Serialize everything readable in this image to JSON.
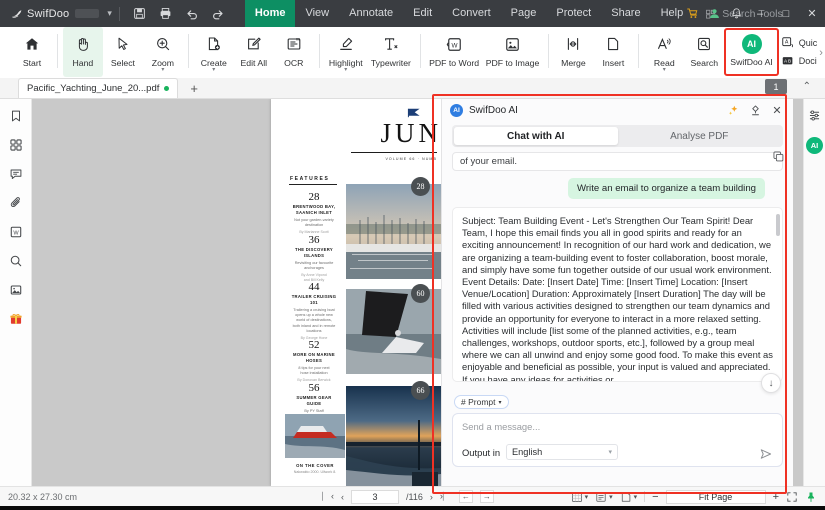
{
  "titlebar": {
    "brand": "SwifDoo",
    "logo_icon": "swifdoo-bird-logo",
    "dropdown_icon": "chevron-down-icon",
    "quick_icons": [
      "save-icon",
      "print-icon",
      "undo-icon",
      "redo-icon"
    ],
    "menus": [
      {
        "label": "Home",
        "active": true
      },
      {
        "label": "View",
        "active": false
      },
      {
        "label": "Annotate",
        "active": false
      },
      {
        "label": "Edit",
        "active": false
      },
      {
        "label": "Convert",
        "active": false
      },
      {
        "label": "Page",
        "active": false
      },
      {
        "label": "Protect",
        "active": false
      },
      {
        "label": "Share",
        "active": false
      },
      {
        "label": "Help",
        "active": false
      }
    ],
    "search_placeholder": "Search Tools",
    "search_icon": "search-tools-icon",
    "right_icons": [
      "cart-icon",
      "account-icon",
      "bell-icon"
    ],
    "window_buttons": {
      "minimize": "–",
      "maximize": "□",
      "close": "✕"
    },
    "accent_active": "#0d8f63",
    "bg": "#3a3d41"
  },
  "ribbon": {
    "groups": [
      {
        "items": [
          {
            "label": "Start",
            "icon": "home-icon",
            "selected": false,
            "caret": false
          }
        ]
      },
      {
        "items": [
          {
            "label": "Hand",
            "icon": "hand-icon",
            "selected": true,
            "caret": false
          },
          {
            "label": "Select",
            "icon": "cursor-icon",
            "selected": false,
            "caret": false
          },
          {
            "label": "Zoom",
            "icon": "zoom-in-icon",
            "selected": false,
            "caret": true
          }
        ]
      },
      {
        "items": [
          {
            "label": "Create",
            "icon": "create-file-icon",
            "selected": false,
            "caret": true
          },
          {
            "label": "Edit All",
            "icon": "edit-pencil-icon",
            "selected": false,
            "caret": false
          },
          {
            "label": "OCR",
            "icon": "ocr-icon",
            "selected": false,
            "caret": false
          }
        ]
      },
      {
        "items": [
          {
            "label": "Highlight",
            "icon": "highlight-marker-icon",
            "selected": false,
            "caret": true
          },
          {
            "label": "Typewriter",
            "icon": "typewriter-icon",
            "selected": false,
            "caret": false
          }
        ]
      },
      {
        "items": [
          {
            "label": "PDF to Word",
            "icon": "pdf-to-word-icon",
            "selected": false,
            "caret": false
          },
          {
            "label": "PDF to Image",
            "icon": "pdf-to-image-icon",
            "selected": false,
            "caret": false
          }
        ]
      },
      {
        "items": [
          {
            "label": "Merge",
            "icon": "merge-icon",
            "selected": false,
            "caret": false
          },
          {
            "label": "Insert",
            "icon": "insert-page-icon",
            "selected": false,
            "caret": false
          }
        ]
      },
      {
        "items": [
          {
            "label": "Read",
            "icon": "read-aloud-icon",
            "selected": false,
            "caret": true
          },
          {
            "label": "Search",
            "icon": "search-doc-icon",
            "selected": false,
            "caret": false
          }
        ]
      }
    ],
    "ai_button": {
      "label": "SwifDoo AI",
      "badge": "AI",
      "highlighted": true,
      "highlight_color": "#ef3124"
    },
    "stack_items": [
      {
        "label": "Quic",
        "icon": "quick-translate-icon"
      },
      {
        "label": "Doci",
        "icon": "document-translate-icon"
      }
    ],
    "overflow_icon": "chevron-right-icon"
  },
  "tabstrip": {
    "document_tab": "Pacific_Yachting_June_20...pdf",
    "modified_dot": true,
    "new_tab_icon": "plus-icon",
    "page_badge": "1",
    "collapse_icon": "chevron-up-icon"
  },
  "left_sidebar": {
    "items": [
      {
        "name": "bookmark-icon",
        "label": "Bookmarks"
      },
      {
        "name": "thumbnails-icon",
        "label": "Thumbnails"
      },
      {
        "name": "comment-icon",
        "label": "Comments"
      },
      {
        "name": "attachment-icon",
        "label": "Attachments"
      },
      {
        "name": "word-convert-icon",
        "label": "Convert to Word"
      },
      {
        "name": "search-icon",
        "label": "Search"
      },
      {
        "name": "image-extract-icon",
        "label": "Extract Image"
      },
      {
        "name": "gift-icon",
        "label": "Gift"
      }
    ]
  },
  "document": {
    "title": "JUN",
    "volume_line": "VOLUME 66 · NUMB",
    "features_heading": "FEATURES",
    "features": [
      {
        "num": "28",
        "title": "BRENTWOOD BAY,\nSAANICH INLET",
        "desc": "Not your garden-variety\ndestination",
        "author": "By Marianne Scott"
      },
      {
        "num": "36",
        "title": "THE DISCOVERY\nISLANDS",
        "desc": "Revisiting our favourite\nanchorages",
        "author": "By Anne Vipond\nand Bill Kelly"
      },
      {
        "num": "44",
        "title": "TRAILER CRUISING\n101",
        "desc": "Trailering a cruising boat\nopens up a whole new\nworld of destinations,\nboth inland and in remote\nlocations",
        "author": "By George Hone"
      },
      {
        "num": "52",
        "title": "MORE ON MARINE\nHOSES",
        "desc": "8 tips for your next\nhose installation",
        "author": "By Donovan Berwick"
      },
      {
        "num": "56",
        "title": "SUMMER GEAR\nGUIDE",
        "desc": "By PY Staff",
        "author": ""
      }
    ],
    "photo_badges": [
      "28",
      "60",
      "66"
    ],
    "cover_caption_title": "ON THE COVER",
    "cover_caption_sub": "Nakwakto 2000. Ullwork 8.",
    "scroll_up_icon": "chevron-up-icon",
    "scroll_down_icon": "chevron-down-icon"
  },
  "right_rail": {
    "items": [
      {
        "name": "settings-sliders-icon",
        "label": "Settings"
      },
      {
        "name": "ai-assistant-icon",
        "label": "AI",
        "badge": "AI"
      }
    ]
  },
  "ai_panel": {
    "badge": "AI",
    "title": "SwifDoo AI",
    "header_icons": [
      {
        "name": "sparkle-icon",
        "glyph": "✦"
      },
      {
        "name": "history-icon",
        "glyph": "⚒"
      },
      {
        "name": "close-icon",
        "glyph": "✕"
      }
    ],
    "tabs": [
      {
        "label": "Chat with AI",
        "active": true
      },
      {
        "label": "Analyse PDF",
        "active": false
      }
    ],
    "previous_snippet": "of your email.",
    "copy_icon": "copy-icon",
    "user_message": "Write an email to organize a team building",
    "assistant_message": "Subject: Team Building Event - Let's Strengthen Our Team Spirit! Dear Team, I hope this email finds you all in good spirits and ready for an exciting announcement! In recognition of our hard work and dedication, we are organizing a team-building event to foster collaboration, boost morale, and simply have some fun together outside of our usual work environment. Event Details: Date: [Insert Date] Time: [Insert Time] Location: [Insert Venue/Location] Duration: Approximately [Insert Duration] The day will be filled with various activities designed to strengthen our team dynamics and provide an opportunity for everyone to interact in a more relaxed setting. Activities will include [list some of the planned activities, e.g., team challenges, workshops, outdoor sports, etc.], followed by a group meal where we can all unwind and enjoy some good food. To make this event as enjoyable and beneficial as possible, your input is valued and appreciated. If you have any ideas for activities or",
    "scroll_down_icon": "arrow-down-circle-icon",
    "prompt_chip": "# Prompt",
    "prompt_chip_caret": "chevron-down-icon",
    "composer_placeholder": "Send a message...",
    "output_label": "Output in",
    "output_language": "English",
    "output_caret": "chevron-down-icon",
    "send_icon": "send-icon",
    "user_bubble_color": "#d6f5e1"
  },
  "statusbar": {
    "page_size": "20.32 x 27.30 cm",
    "first_page_icon": "first-page-icon",
    "prev_page_icon": "prev-page-icon",
    "current_page": "3",
    "total_pages": "/116",
    "next_page_icon": "next-page-icon",
    "last_page_icon": "last-page-icon",
    "prev_view_icon": "previous-view-icon",
    "next_view_icon": "next-view-icon",
    "view_modes": [
      {
        "name": "page-layout-icon"
      },
      {
        "name": "scroll-mode-icon"
      },
      {
        "name": "page-fit-icon"
      }
    ],
    "zoom_out": "−",
    "zoom_label": "Fit Page",
    "zoom_in": "+",
    "fullscreen_icon": "fullscreen-icon",
    "pin-icon": "pin-icon"
  }
}
